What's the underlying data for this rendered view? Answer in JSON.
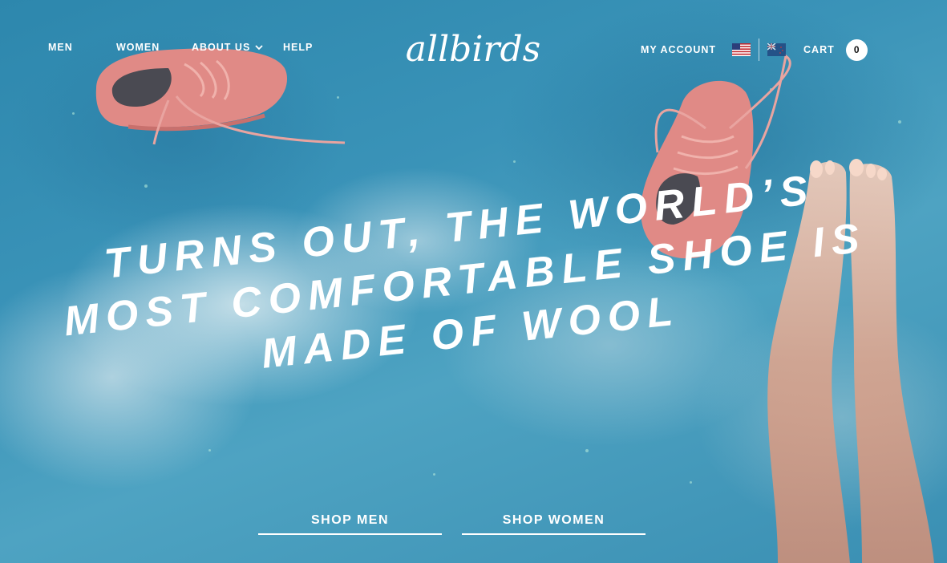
{
  "brand": {
    "logo_text": "allbirds"
  },
  "nav_left": {
    "men": "MEN",
    "women": "WOMEN",
    "about": "ABOUT US",
    "help": "HELP"
  },
  "nav_right": {
    "account": "MY ACCOUNT",
    "flags": [
      "us-flag-icon",
      "nz-flag-icon"
    ],
    "cart": "CART",
    "cart_count": "0"
  },
  "hero": {
    "headline_lines": [
      "TURNS OUT, THE WORLD’S",
      "MOST COMFORTABLE SHOE IS",
      "MADE OF WOOL"
    ],
    "shop_men": "SHOP MEN",
    "shop_women": "SHOP WOMEN"
  },
  "colors": {
    "water": "#3a93b8",
    "shoe": "#e08a86",
    "text": "#ffffff"
  }
}
